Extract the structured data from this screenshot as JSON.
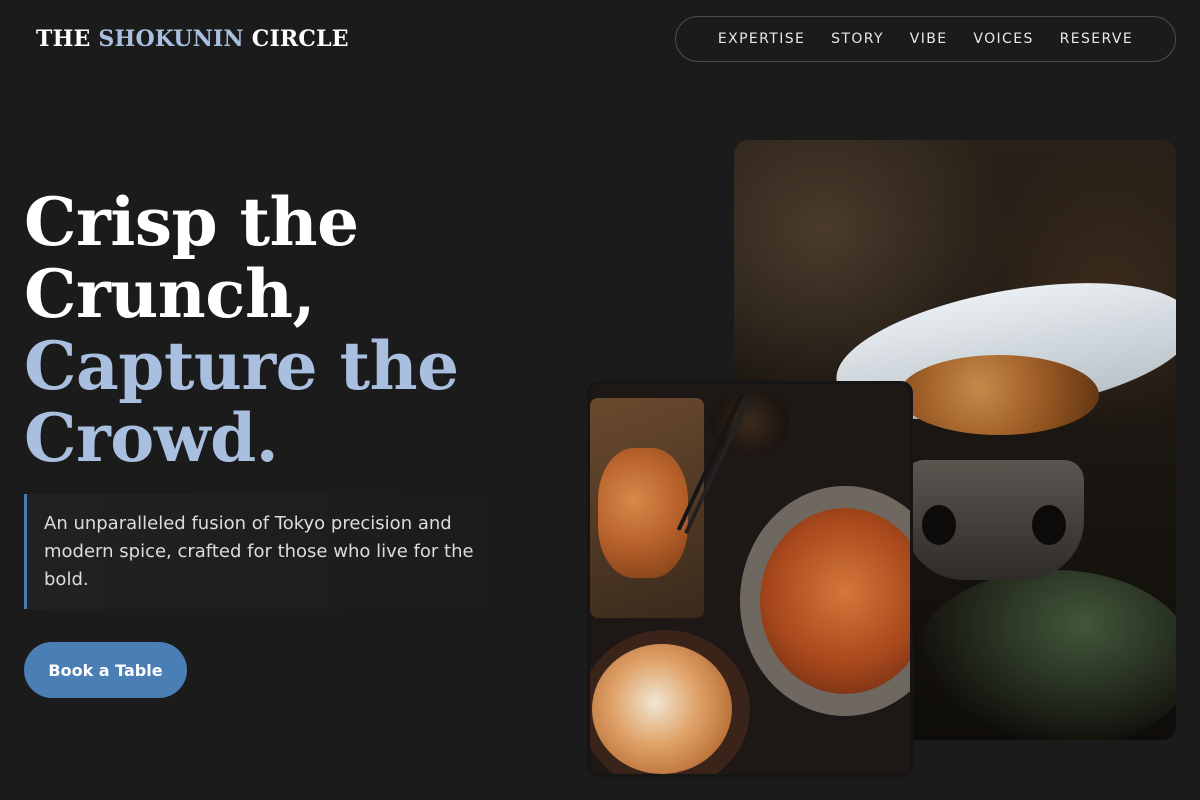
{
  "brand": {
    "part1": "THE ",
    "accent": "SHOKUNIN",
    "part2": " CIRCLE"
  },
  "nav": {
    "items": [
      "EXPERTISE",
      "STORY",
      "VIBE",
      "VOICES",
      "RESERVE"
    ]
  },
  "hero": {
    "headline_lines": [
      "Crisp the",
      "Crunch,"
    ],
    "headline_accent_lines": [
      "Capture the",
      "Crowd."
    ],
    "lede": "An unparalleled fusion of Tokyo precision and modern spice, crafted for those who live for the bold.",
    "cta_label": "Book a Table"
  },
  "images": {
    "main": "hotpot-photo",
    "inset": "ramen-set-photo"
  },
  "colors": {
    "background": "#1b1b1b",
    "accent": "#a9bfdf",
    "button": "#4a7fb5"
  }
}
